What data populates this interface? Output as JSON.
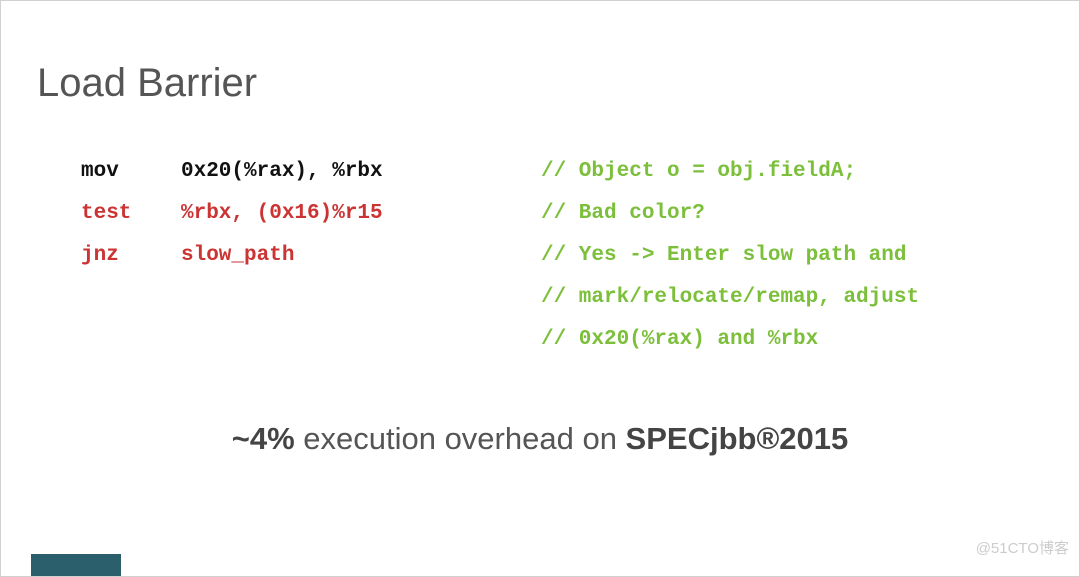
{
  "title": "Load Barrier",
  "code": {
    "rows": [
      {
        "opcode": "mov",
        "operand": "0x20(%rax), %rbx",
        "comment": "// Object o = obj.fieldA;",
        "style": "black"
      },
      {
        "opcode": "test",
        "operand": "%rbx, (0x16)%r15",
        "comment": "// Bad color?",
        "style": "red"
      },
      {
        "opcode": "jnz",
        "operand": "slow_path",
        "comment": "// Yes -> Enter slow path and",
        "style": "red"
      },
      {
        "opcode": "",
        "operand": "",
        "comment": "// mark/relocate/remap, adjust",
        "style": "none"
      },
      {
        "opcode": "",
        "operand": "",
        "comment": "// 0x20(%rax) and %rbx",
        "style": "none"
      }
    ]
  },
  "caption": {
    "pct": "~4%",
    "mid": " execution overhead on ",
    "suffix": "SPECjbb®2015"
  },
  "watermark": "@51CTO博客"
}
